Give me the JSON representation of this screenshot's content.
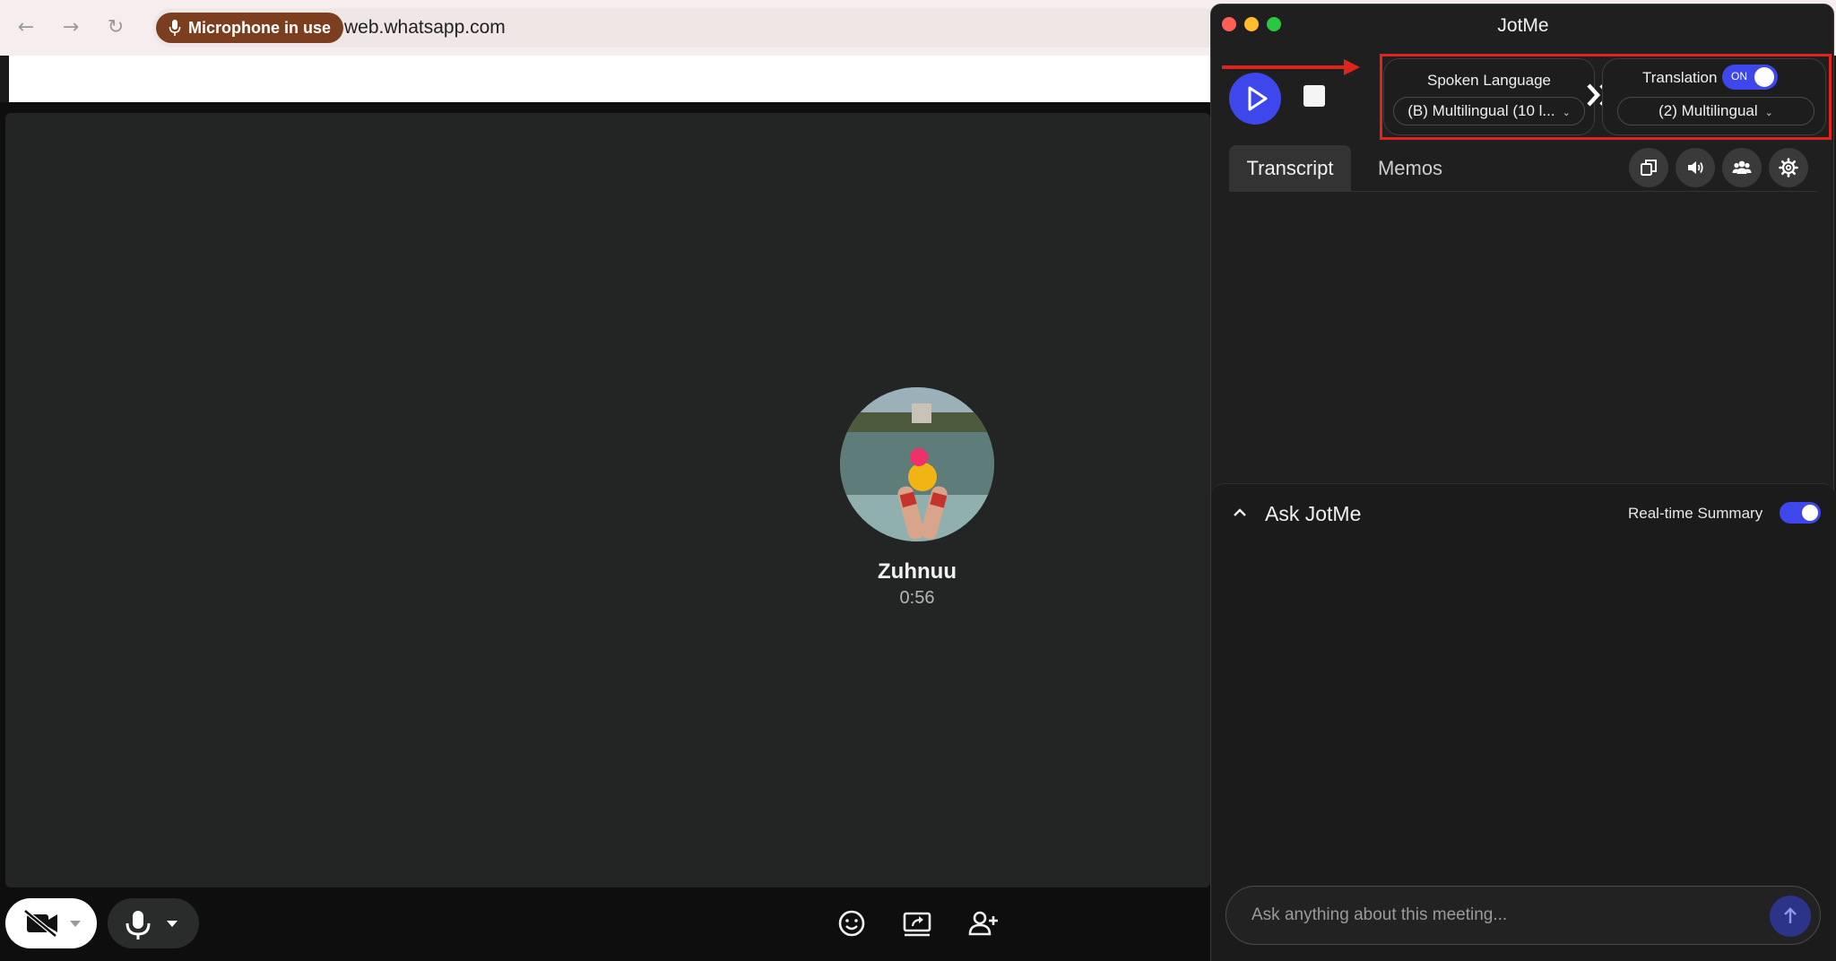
{
  "browser": {
    "back_icon": "arrow-left-icon",
    "forward_icon": "arrow-right-icon",
    "reload_icon": "reload-icon",
    "mic_indicator": "Microphone in use",
    "url": "web.whatsapp.com"
  },
  "call": {
    "caller_name": "Zuhnuu",
    "timer": "0:56",
    "controls": [
      "video-off-icon",
      "microphone-icon",
      "emoji-icon",
      "screen-share-icon",
      "add-person-icon"
    ]
  },
  "jotme": {
    "title": "JotMe",
    "spoken_language": {
      "label": "Spoken Language",
      "selected": "(B) Multilingual (10 l..."
    },
    "translation": {
      "label": "Translation",
      "toggle_label": "ON",
      "selected": "(2) Multilingual"
    },
    "tabs": [
      "Transcript",
      "Memos"
    ],
    "tool_icons": [
      "copy-icon",
      "speaker-icon",
      "people-icon",
      "gear-icon"
    ],
    "ask": {
      "title": "Ask JotMe",
      "realtime_label": "Real-time Summary",
      "placeholder": "Ask anything about this meeting..."
    }
  },
  "colors": {
    "accent": "#3d47ec",
    "highlight": "#e0231b",
    "mic_pill": "#7b3f1f"
  }
}
